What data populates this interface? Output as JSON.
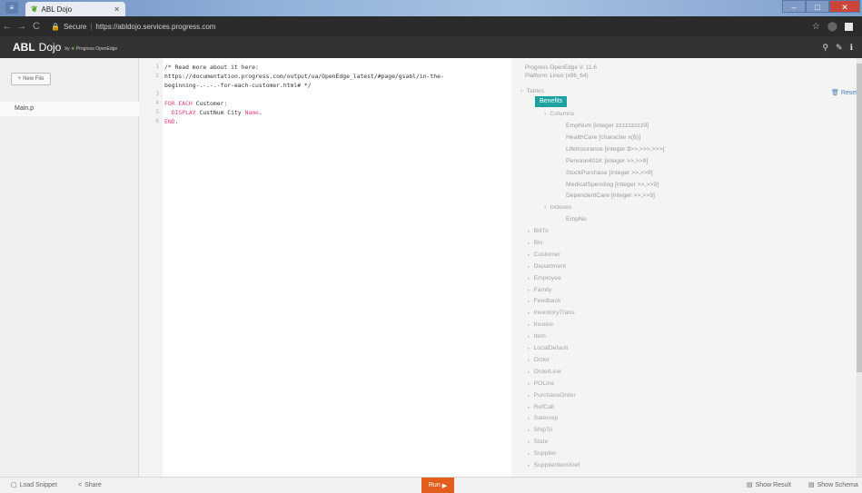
{
  "browser": {
    "tab_title": "ABL Dojo",
    "secure_label": "Secure",
    "url": "https://abldojo.services.progress.com"
  },
  "app": {
    "brand_bold": "ABL",
    "brand_light": "Dojo",
    "brand_by": "by",
    "brand_company": "Progress OpenEdge"
  },
  "sidebar": {
    "new_file_label": "New File",
    "files": [
      "Main.p"
    ]
  },
  "editor": {
    "lines": [
      {
        "num": "1",
        "text": "/* Read more about it here:"
      },
      {
        "num": "2",
        "text": "https://documentation.progress.com/output/ua/OpenEdge_latest/#page/gsabl/in-the-"
      },
      {
        "num": "",
        "text": "beginning-.-.-.-for-each-customer.html# */"
      },
      {
        "num": "3",
        "text": ""
      },
      {
        "num": "4",
        "kw": "FOR EACH",
        "text": " Customer:"
      },
      {
        "num": "5",
        "kw": "DISPLAY",
        "text": " CustNum City ",
        "kw2": "Name",
        "text2": "."
      },
      {
        "num": "6",
        "kw": "END",
        "text": "."
      }
    ]
  },
  "schema": {
    "version": "Progress OpenEdge V. 11.6",
    "platform": "Platform: Linux (x86_64)",
    "tables_label": "Tables",
    "reset_label": "Reset",
    "selected_table": "Benefits",
    "columns_label": "Columns",
    "columns": [
      "EmpNum [integer zzzzzzzzz9]",
      "HealthCare [character x(8)]",
      "LifeInsurance [integer $>>,>>>,>>>]",
      "Pension401K [integer >>,>>9]",
      "StockPurchase [integer >>,>>9]",
      "MedicalSpending [integer >>,>>9]",
      "DependentCare [integer >>,>>9]"
    ],
    "indexes_label": "Indexes",
    "indexes": [
      "EmpNo"
    ],
    "tables": [
      "BillTo",
      "Bin",
      "Customer",
      "Department",
      "Employee",
      "Family",
      "Feedback",
      "InventoryTrans",
      "Invoice",
      "Item",
      "LocalDefault",
      "Order",
      "OrderLine",
      "POLine",
      "PurchaseOrder",
      "RefCall",
      "Salesrep",
      "ShipTo",
      "State",
      "Supplier",
      "SupplierItemXref"
    ]
  },
  "footer": {
    "load_snippet": "Load Snippet",
    "share": "Share",
    "run": "Run",
    "show_result": "Show Result",
    "show_schema": "Show Schema"
  }
}
